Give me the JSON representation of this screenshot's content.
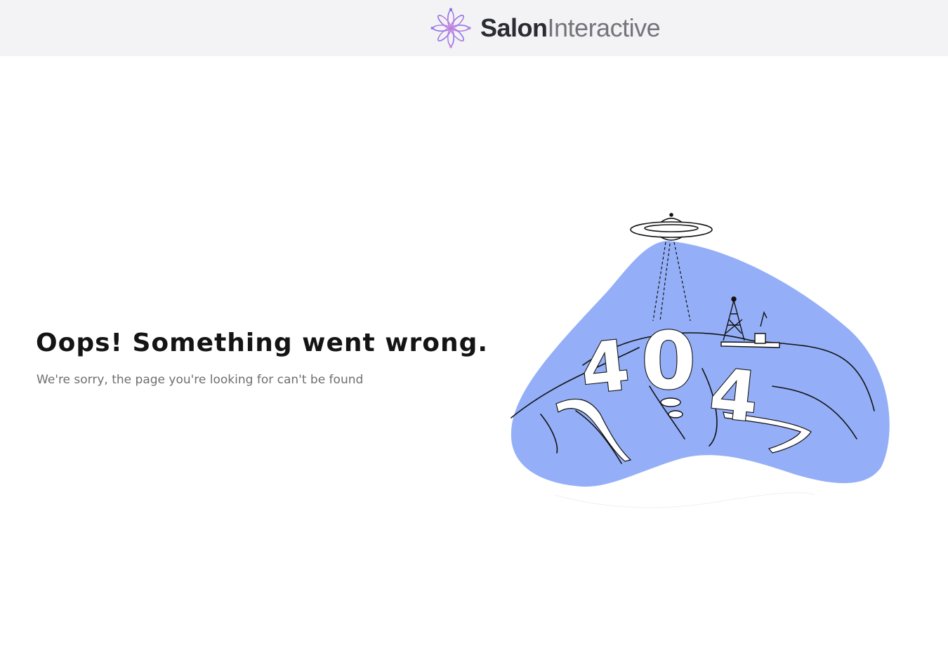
{
  "header": {
    "brand": {
      "name_part1": "Salon",
      "name_part2": "Interactive",
      "icon": "flower-logo-icon"
    }
  },
  "error": {
    "title": "Oops! Something went wrong.",
    "message": "We're sorry, the page you're looking for can't be found"
  },
  "illustration": {
    "digits": [
      "4",
      "0",
      "4"
    ],
    "blob_color": "#94aff7",
    "icons": [
      "ufo-icon",
      "radio-tower-icon"
    ]
  }
}
